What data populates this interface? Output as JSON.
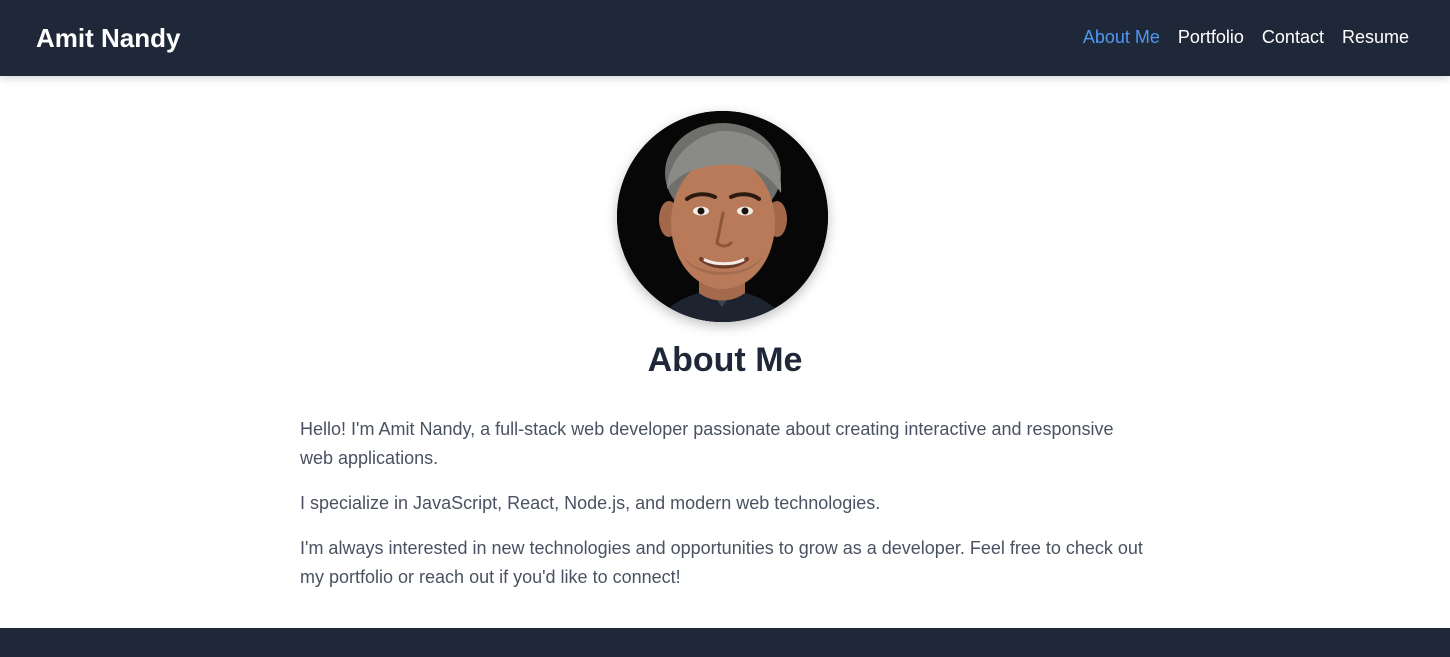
{
  "header": {
    "brand": "Amit Nandy",
    "nav": [
      {
        "label": "About Me",
        "active": true
      },
      {
        "label": "Portfolio",
        "active": false
      },
      {
        "label": "Contact",
        "active": false
      },
      {
        "label": "Resume",
        "active": false
      }
    ]
  },
  "main": {
    "title": "About Me",
    "paragraphs": [
      "Hello! I'm Amit Nandy, a full-stack web developer passionate about creating interactive and responsive web applications.",
      "I specialize in JavaScript, React, Node.js, and modern web technologies.",
      "I'm always interested in new technologies and opportunities to grow as a developer. Feel free to check out my portfolio or reach out if you'd like to connect!"
    ]
  },
  "colors": {
    "header_bg": "#1f2838",
    "nav_active": "#4f97f1",
    "nav_text": "#ffffff",
    "title": "#1f2838",
    "body_text": "#4a5261",
    "footer_bg": "#1f2838"
  }
}
